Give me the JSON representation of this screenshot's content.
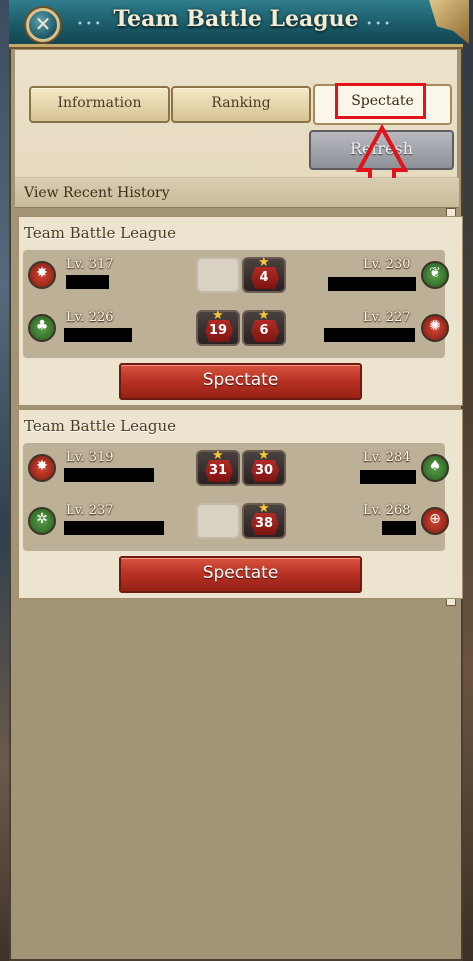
{
  "window": {
    "title": "Team Battle League",
    "close_icon": "close-x-icon"
  },
  "tabs": [
    {
      "label": "Information",
      "active": false
    },
    {
      "label": "Ranking",
      "active": false
    },
    {
      "label": "Spectate",
      "active": true
    }
  ],
  "refresh_label": "Refresh",
  "history": {
    "header": "View Recent History"
  },
  "matches": [
    {
      "title": "Team Battle League",
      "rows": [
        {
          "left_level": "Lv. 317",
          "left_icon": "red-star-emblem-icon",
          "left_score": "",
          "right_score": "4",
          "right_level": "Lv. 230",
          "right_icon": "green-emblem-icon"
        },
        {
          "left_level": "Lv. 226",
          "left_icon": "green-tree-emblem-icon",
          "left_score": "19",
          "right_score": "6",
          "right_level": "Lv. 227",
          "right_icon": "red-emblem-icon"
        }
      ],
      "spectate_label": "Spectate"
    },
    {
      "title": "Team Battle League",
      "rows": [
        {
          "left_level": "Lv. 319",
          "left_icon": "red-star-emblem-icon",
          "left_score": "31",
          "right_score": "30",
          "right_level": "Lv. 284",
          "right_icon": "green-emblem-icon"
        },
        {
          "left_level": "Lv. 237",
          "left_icon": "green-emblem-icon",
          "left_score": "",
          "right_score": "38",
          "right_level": "Lv. 268",
          "right_icon": "red-crosshair-emblem-icon"
        }
      ],
      "spectate_label": "Spectate"
    }
  ],
  "colors": {
    "title_bar": "#1d5f6d",
    "highlight": "#e3131b",
    "spectate_button": "#b63023",
    "star": "#f4c93a"
  }
}
